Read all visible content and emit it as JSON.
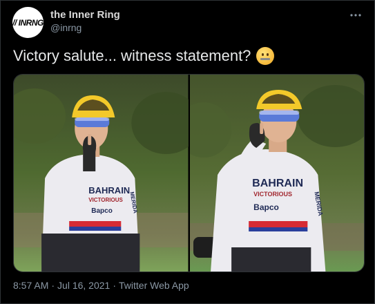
{
  "author": {
    "display_name": "the Inner Ring",
    "handle": "@inrng",
    "avatar_text": "// INRNG"
  },
  "more_icon": "more-horizontal-icon",
  "tweet": {
    "text": "Victory salute... witness statement?",
    "emoji": "zipper-mouth-face"
  },
  "media": {
    "photos": [
      {
        "jersey_text_1": "BAHRAIN",
        "jersey_text_2": "VICTORIOUS",
        "jersey_text_3": "Bapco",
        "side_text": "MERIDA"
      },
      {
        "jersey_text_1": "BAHRAIN",
        "jersey_text_2": "VICTORIOUS",
        "jersey_text_3": "Bapco",
        "side_text": "MERIDA"
      }
    ]
  },
  "meta": {
    "time": "8:57 AM",
    "date": "Jul 16, 2021",
    "source": "Twitter Web App"
  },
  "colors": {
    "background": "#000000",
    "primary_text": "#e7e9ea",
    "secondary_text": "#8b98a5",
    "border": "#2f3336"
  }
}
